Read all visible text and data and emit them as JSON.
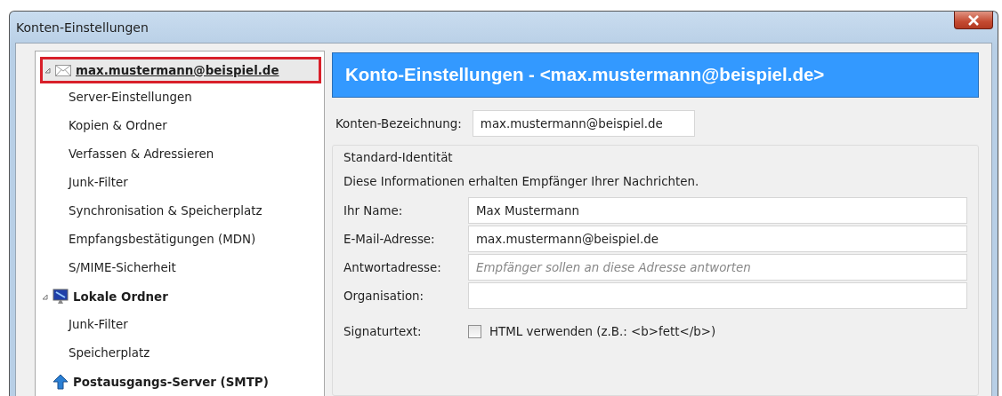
{
  "window": {
    "title": "Konten-Einstellungen"
  },
  "tree": [
    {
      "label": "max.mustermann@beispiel.de",
      "kind": "account",
      "expanded": true,
      "selected": true,
      "children": [
        {
          "label": "Server-Einstellungen",
          "selected": false
        },
        {
          "label": "Kopien & Ordner",
          "selected": false
        },
        {
          "label": "Verfassen & Adressieren",
          "selected": false
        },
        {
          "label": "Junk-Filter",
          "selected": false
        },
        {
          "label": "Synchronisation & Speicherplatz",
          "selected": false
        },
        {
          "label": "Empfangsbestätigungen (MDN)",
          "selected": false
        },
        {
          "label": "S/MIME-Sicherheit",
          "selected": false
        }
      ]
    },
    {
      "label": "Lokale Ordner",
      "kind": "local",
      "expanded": true,
      "selected": false,
      "children": [
        {
          "label": "Junk-Filter",
          "selected": false
        },
        {
          "label": "Speicherplatz",
          "selected": false
        }
      ]
    },
    {
      "label": "Postausgangs-Server (SMTP)",
      "kind": "smtp",
      "selected": false
    }
  ],
  "panel": {
    "header": "Konto-Einstellungen - <max.mustermann@beispiel.de>",
    "account_name": {
      "label": "Konten-Bezeichnung:",
      "value": "max.mustermann@beispiel.de"
    },
    "identity": {
      "legend": "Standard-Identität",
      "info": "Diese Informationen erhalten Empfänger Ihrer Nachrichten.",
      "fields": [
        {
          "label": "Ihr Name:",
          "value": "Max Mustermann"
        },
        {
          "label": "E-Mail-Adresse:",
          "value": "max.mustermann@beispiel.de"
        },
        {
          "label": "Antwortadresse:",
          "placeholder": "Empfänger sollen an diese Adresse antworten"
        },
        {
          "label": "Organisation:"
        }
      ],
      "signature": {
        "label": "Signaturtext:",
        "checkbox": "HTML verwenden (z.B.: <b>fett</b>)",
        "checked": false
      }
    }
  }
}
